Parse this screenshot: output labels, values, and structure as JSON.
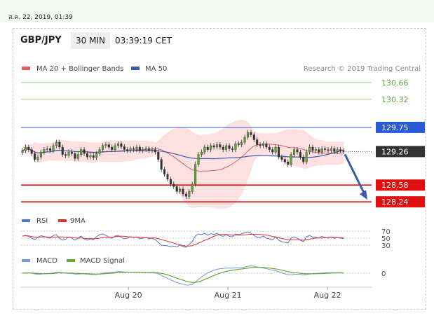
{
  "header": {
    "date_stamp": "ส.ค. 22, 2019, 01:39",
    "symbol": "GBP/JPY",
    "timeframe": "30 MIN",
    "time": "03:39:19 CET"
  },
  "legend": {
    "ma20": "MA 20 + Bollinger Bands",
    "ma50": "MA 50",
    "copyright": "Research © 2019 Trading Central",
    "rsi": "RSI",
    "rsi_signal": "9MA",
    "macd": "MACD",
    "macd_signal": "MACD Signal"
  },
  "colors": {
    "candle": "#55aa33",
    "ma20": "#e06060",
    "band_fill": "#fde0e0",
    "ma50": "#3b5ca8",
    "resistance": "#2a5bd7",
    "support": "#e01010",
    "target_green": "#9fd48a",
    "price_tag": "#333333",
    "arrow": "#3b5ca8",
    "rsi": "#5577cc",
    "rsi_ma": "#dd3333",
    "macd": "#7799dd",
    "macd_sig": "#66aa33"
  },
  "chart_data": {
    "type": "candlestick",
    "x_ticks": [
      "Aug 20",
      "Aug 21",
      "Aug 22"
    ],
    "price_ylim": [
      128.1,
      130.8
    ],
    "levels": [
      {
        "value": 130.66,
        "label": "130.66",
        "kind": "target"
      },
      {
        "value": 130.32,
        "label": "130.32",
        "kind": "target"
      },
      {
        "value": 129.75,
        "label": "129.75",
        "kind": "resistance"
      },
      {
        "value": 129.26,
        "label": "129.26",
        "kind": "current"
      },
      {
        "value": 128.58,
        "label": "128.58",
        "kind": "support"
      },
      {
        "value": 128.24,
        "label": "128.24",
        "kind": "support"
      }
    ],
    "close": [
      129.28,
      129.35,
      129.3,
      129.22,
      129.1,
      129.15,
      129.25,
      129.3,
      129.32,
      129.28,
      129.38,
      129.45,
      129.35,
      129.2,
      129.18,
      129.25,
      129.22,
      129.12,
      129.2,
      129.3,
      129.22,
      129.15,
      129.18,
      129.14,
      129.22,
      129.3,
      129.38,
      129.4,
      129.35,
      129.3,
      129.38,
      129.42,
      129.36,
      129.3,
      129.28,
      129.32,
      129.3,
      129.35,
      129.28,
      129.3,
      129.32,
      129.28,
      129.3,
      129.25,
      129.1,
      128.9,
      128.8,
      128.7,
      128.6,
      128.55,
      128.45,
      128.5,
      128.4,
      128.35,
      128.45,
      128.6,
      129.0,
      129.2,
      129.25,
      129.35,
      129.3,
      129.38,
      129.35,
      129.4,
      129.35,
      129.3,
      129.38,
      129.32,
      129.3,
      129.42,
      129.4,
      129.45,
      129.55,
      129.65,
      129.6,
      129.5,
      129.4,
      129.38,
      129.42,
      129.35,
      129.3,
      129.25,
      129.35,
      129.15,
      129.1,
      129.05,
      129.0,
      129.2,
      129.3,
      129.25,
      129.15,
      129.05,
      129.25,
      129.35,
      129.28,
      129.3,
      129.25,
      129.32,
      129.3,
      129.28,
      129.32,
      129.26,
      129.3,
      129.28,
      129.26
    ],
    "rsi_levels": [
      {
        "value": 70,
        "label": "70"
      },
      {
        "value": 50,
        "label": "50"
      },
      {
        "value": 30,
        "label": "30"
      }
    ],
    "rsi": [
      56,
      58,
      55,
      50,
      46,
      52,
      57,
      55,
      52,
      50,
      58,
      60,
      50,
      44,
      47,
      53,
      50,
      44,
      50,
      56,
      48,
      44,
      48,
      45,
      54,
      60,
      62,
      58,
      53,
      50,
      56,
      58,
      52,
      48,
      50,
      54,
      52,
      54,
      48,
      50,
      52,
      48,
      50,
      46,
      38,
      30,
      29,
      28,
      26,
      27,
      25,
      30,
      26,
      24,
      32,
      40,
      56,
      62,
      60,
      64,
      58,
      63,
      60,
      64,
      58,
      55,
      60,
      55,
      54,
      62,
      60,
      62,
      66,
      68,
      64,
      58,
      52,
      52,
      56,
      50,
      48,
      45,
      54,
      44,
      40,
      38,
      36,
      50,
      54,
      50,
      44,
      40,
      54,
      58,
      52,
      53,
      50,
      55,
      52,
      50,
      54,
      49,
      52,
      50,
      49
    ],
    "macd_zero_label": "0"
  }
}
